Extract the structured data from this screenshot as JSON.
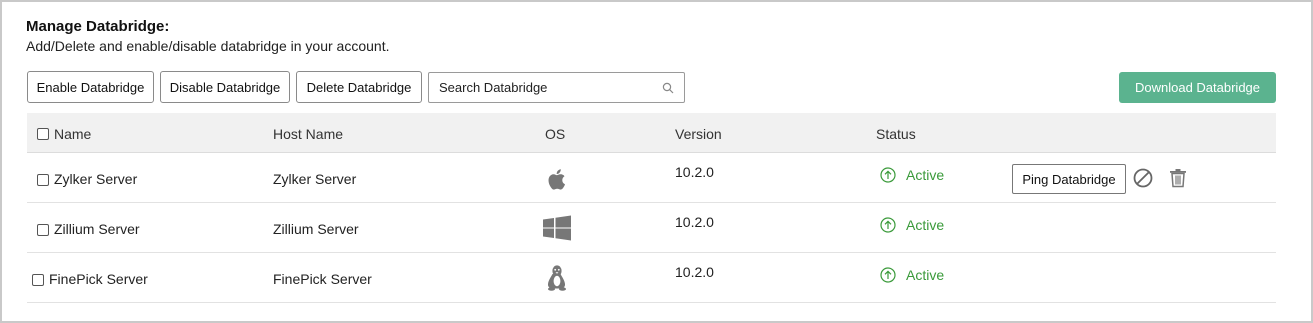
{
  "header": {
    "title": "Manage Databridge:",
    "subtitle": "Add/Delete and enable/disable databridge in your account."
  },
  "toolbar": {
    "enable_label": "Enable Databridge",
    "disable_label": "Disable Databridge",
    "delete_label": "Delete Databridge",
    "search_placeholder": "Search Databridge",
    "search_icon": "search-icon",
    "download_label": "Download Databridge",
    "download_color": "#5bb38f"
  },
  "table": {
    "columns": [
      "Name",
      "Host Name",
      "OS",
      "Version",
      "Status"
    ],
    "rows": [
      {
        "name": "Zylker Server",
        "host": "Zylker Server",
        "os_icon": "apple-icon",
        "version": "10.2.0",
        "status": "Active",
        "actions": {
          "ping_label": "Ping Databridge",
          "disable_icon": "disable-icon",
          "delete_icon": "trash-icon"
        }
      },
      {
        "name": "Zillium Server",
        "host": "Zillium Server",
        "os_icon": "windows-icon",
        "version": "10.2.0",
        "status": "Active"
      },
      {
        "name": "FinePick Server",
        "host": "FinePick Server",
        "os_icon": "linux-icon",
        "version": "10.2.0",
        "status": "Active"
      }
    ]
  },
  "colors": {
    "active_status": "#3a9a3a",
    "header_bg": "#f1f1f1",
    "icon_gray": "#777777"
  }
}
